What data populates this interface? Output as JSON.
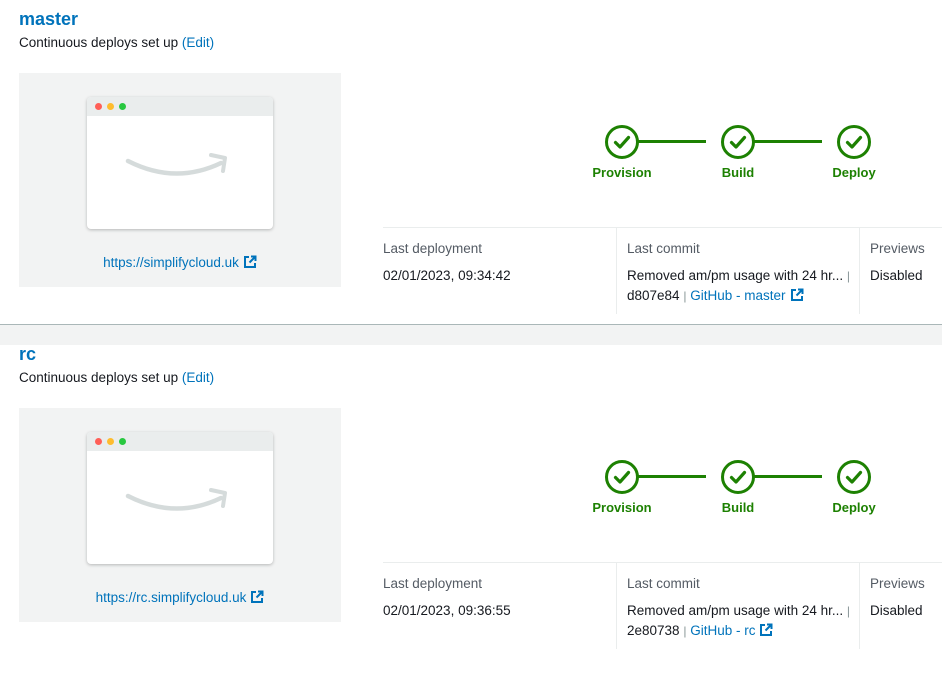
{
  "branches": [
    {
      "name": "master",
      "deploy_status": "Continuous deploys set up",
      "edit_label": "(Edit)",
      "url": "https://simplifycloud.uk",
      "steps": [
        "Provision",
        "Build",
        "Deploy"
      ],
      "last_deployment_label": "Last deployment",
      "last_deployment_value": "02/01/2023, 09:34:42",
      "last_commit_label": "Last commit",
      "commit_message": "Removed am/pm usage with 24 hr...",
      "commit_sep": "|",
      "commit_hash": "d807e84",
      "commit_repo_link": "GitHub - master",
      "previews_label": "Previews",
      "previews_value": "Disabled"
    },
    {
      "name": "rc",
      "deploy_status": "Continuous deploys set up",
      "edit_label": "(Edit)",
      "url": "https://rc.simplifycloud.uk",
      "steps": [
        "Provision",
        "Build",
        "Deploy"
      ],
      "last_deployment_label": "Last deployment",
      "last_deployment_value": "02/01/2023, 09:36:55",
      "last_commit_label": "Last commit",
      "commit_message": "Removed am/pm usage with 24 hr...",
      "commit_sep": "|",
      "commit_hash": "2e80738",
      "commit_repo_link": "GitHub - rc",
      "previews_label": "Previews",
      "previews_value": "Disabled"
    }
  ],
  "colors": {
    "link": "#0073bb",
    "success": "#1d8102",
    "panel_bg": "#f2f3f3"
  },
  "icons": {
    "step_complete": "check-circle-icon",
    "external_link": "external-link-icon",
    "amazon_smile": "amazon-smile-logo"
  }
}
